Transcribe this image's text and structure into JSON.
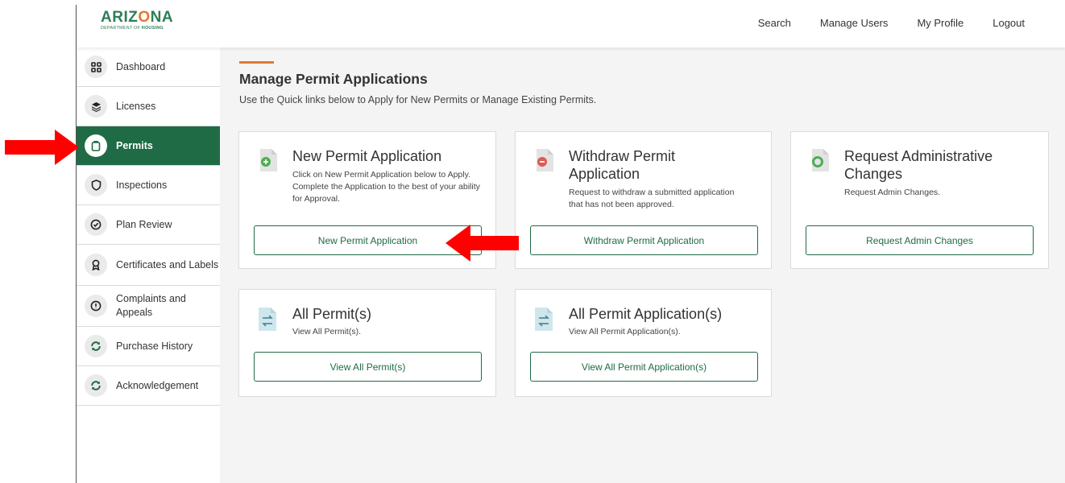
{
  "brand": {
    "logo_word_1": "ARIZ",
    "logo_word_o": "O",
    "logo_word_2": "NA",
    "logo_sub_1": "DEPARTMENT OF ",
    "logo_sub_2": "HOUSING"
  },
  "nav": {
    "search": "Search",
    "manage_users": "Manage Users",
    "my_profile": "My Profile",
    "logout": "Logout"
  },
  "sidebar": {
    "items": [
      {
        "label": "Dashboard",
        "icon": "grid-icon"
      },
      {
        "label": "Licenses",
        "icon": "layers-icon"
      },
      {
        "label": "Permits",
        "icon": "clipboard-icon",
        "active": true
      },
      {
        "label": "Inspections",
        "icon": "shield-icon"
      },
      {
        "label": "Plan Review",
        "icon": "check-circle-icon"
      },
      {
        "label": "Certificates and Labels",
        "icon": "award-icon"
      },
      {
        "label": "Complaints and Appeals",
        "icon": "alert-circle-icon"
      },
      {
        "label": "Purchase History",
        "icon": "refresh-icon"
      },
      {
        "label": "Acknowledgement",
        "icon": "refresh-icon"
      }
    ]
  },
  "main": {
    "title": "Manage Permit Applications",
    "subtitle": "Use the Quick links below to Apply for New Permits or Manage Existing Permits."
  },
  "cards": {
    "new": {
      "title": "New Permit Application",
      "desc": "Click on New Permit Application below to Apply. Complete the Application to the best of your ability for Approval.",
      "button": "New Permit Application"
    },
    "withdraw": {
      "title": "Withdraw Permit Application",
      "desc": "Request to withdraw a submitted application that has not been approved.",
      "button": "Withdraw Permit Application"
    },
    "admin": {
      "title": "Request Administrative Changes",
      "desc": "Request Admin Changes.",
      "button": "Request Admin Changes"
    },
    "all_permits": {
      "title": "All Permit(s)",
      "desc": "View All Permit(s).",
      "button": "View All Permit(s)"
    },
    "all_apps": {
      "title": "All Permit Application(s)",
      "desc": "View All Permit Application(s).",
      "button": "View All Permit Application(s)"
    }
  },
  "colors": {
    "brand_green": "#1f6b45",
    "accent_orange": "#e07a34",
    "annotation_red": "#ff0000"
  }
}
